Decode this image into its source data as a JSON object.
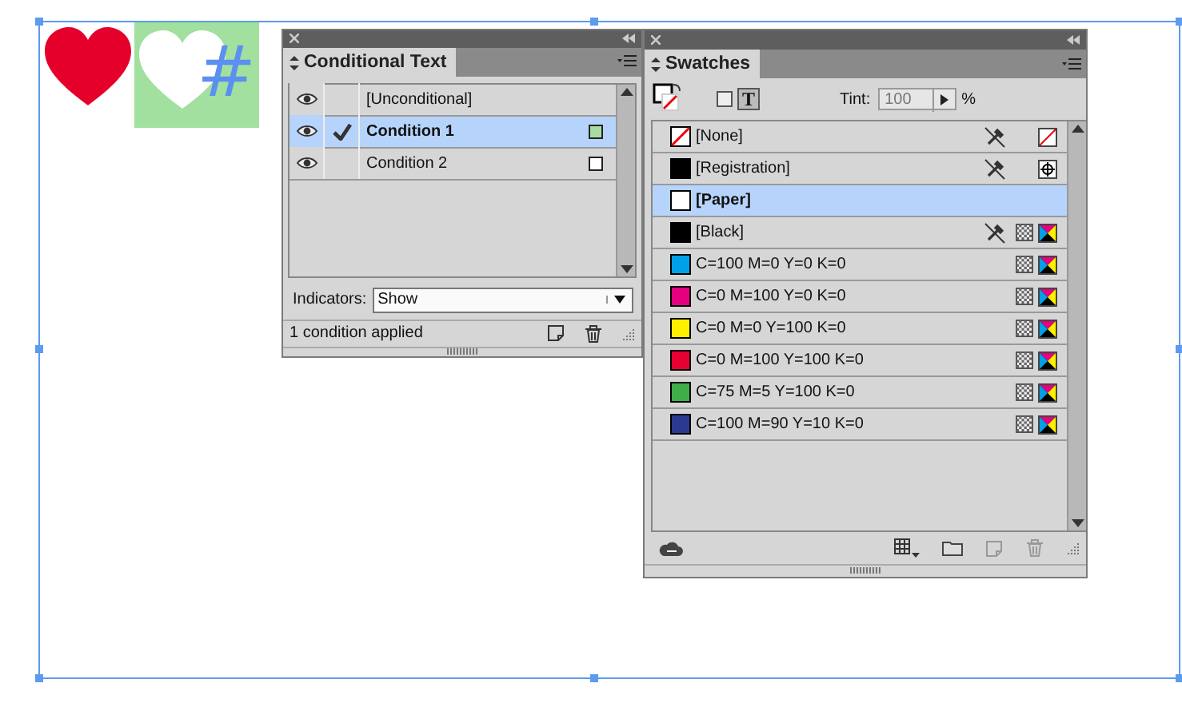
{
  "canvas": {
    "glyph": "#"
  },
  "conditional_text": {
    "title": "Conditional Text",
    "conditions": [
      {
        "name": "[Unconditional]",
        "visible": true,
        "applied": false,
        "selected": false
      },
      {
        "name": "Condition 1",
        "visible": true,
        "applied": true,
        "selected": true,
        "color": "#a8dca0"
      },
      {
        "name": "Condition 2",
        "visible": true,
        "applied": false,
        "selected": false,
        "color": "#ffffff"
      }
    ],
    "indicators_label": "Indicators:",
    "indicators_value": "Show",
    "status": "1 condition applied"
  },
  "swatches": {
    "title": "Swatches",
    "text_button": "T",
    "tint_label": "Tint:",
    "tint_value": "100",
    "percent": "%",
    "items": [
      {
        "name": "[None]",
        "kind": "none",
        "locked": true,
        "selected": false
      },
      {
        "name": "[Registration]",
        "kind": "registration",
        "color": "#000000",
        "locked": true,
        "selected": false
      },
      {
        "name": "[Paper]",
        "kind": "paper",
        "color": "#ffffff",
        "locked": false,
        "selected": true
      },
      {
        "name": "[Black]",
        "kind": "process",
        "color": "#000000",
        "locked": true,
        "selected": false
      },
      {
        "name": "C=100 M=0 Y=0 K=0",
        "kind": "process",
        "color": "#00a0e6",
        "locked": false,
        "selected": false
      },
      {
        "name": "C=0 M=100 Y=0 K=0",
        "kind": "process",
        "color": "#e4007f",
        "locked": false,
        "selected": false
      },
      {
        "name": "C=0 M=0 Y=100 K=0",
        "kind": "process",
        "color": "#fff000",
        "locked": false,
        "selected": false
      },
      {
        "name": "C=0 M=100 Y=100 K=0",
        "kind": "process",
        "color": "#e60033",
        "locked": false,
        "selected": false
      },
      {
        "name": "C=75 M=5 Y=100 K=0",
        "kind": "process",
        "color": "#3fae49",
        "locked": false,
        "selected": false
      },
      {
        "name": "C=100 M=90 Y=10 K=0",
        "kind": "process",
        "color": "#2b3990",
        "locked": false,
        "selected": false
      }
    ]
  }
}
